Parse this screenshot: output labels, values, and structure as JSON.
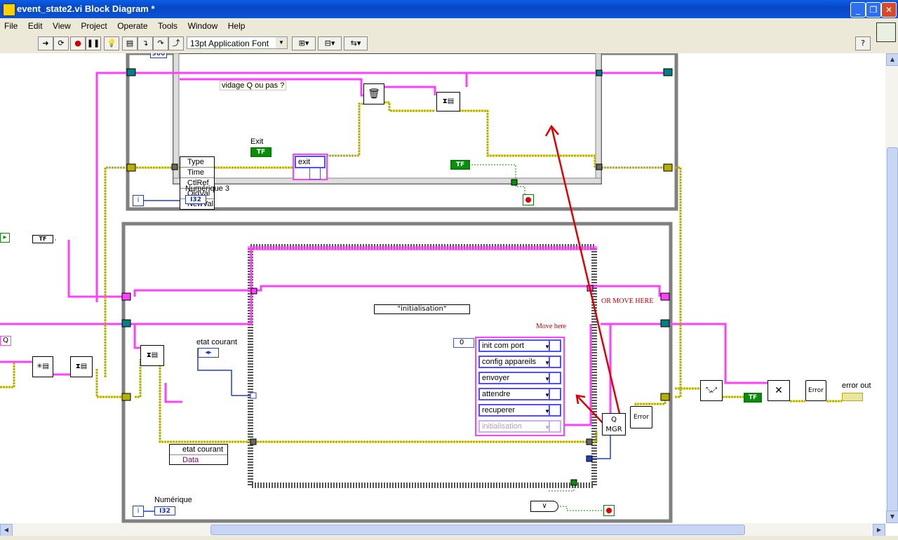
{
  "window": {
    "title": "event_state2.vi Block Diagram *"
  },
  "menu": [
    "File",
    "Edit",
    "View",
    "Project",
    "Operate",
    "Tools",
    "Window",
    "Help"
  ],
  "toolbar": {
    "font": "13pt Application Font",
    "help": "?"
  },
  "top_loop": {
    "constant_900": "900",
    "event_note": "vidage Q ou pas ?",
    "event_fields": [
      "Type",
      "Time",
      "CtlRef",
      "OldVal",
      "NewVal"
    ],
    "exit_enum": "exit",
    "exit_label": "Exit",
    "tf": "TF",
    "num_label": "Numérique 3",
    "i32": "I32",
    "iter": "i"
  },
  "bottom_loop": {
    "case_selector": "\"initialisation\"",
    "etat_courant_label": "etat courant",
    "cluster_fields": [
      "etat courant",
      "Data"
    ],
    "move_here": "Move here",
    "or_move_here": "OR MOVE HERE",
    "array_index": "0",
    "states": [
      "init com port",
      "config appareils",
      "envoyer",
      "attendre",
      "recuperer",
      "initialisation"
    ],
    "qmgr": "Q MGR",
    "error": "Error",
    "num_label": "Numérique",
    "i32": "I32",
    "iter": "i"
  },
  "outside": {
    "q": "Q",
    "tf": "TF",
    "error_out": "error out"
  },
  "colors": {
    "pink": "#ff40ff",
    "yellow": "#b8b000",
    "blue": "#2040c0",
    "red_arrow": "#e00000",
    "green": "#0a8f0a"
  }
}
